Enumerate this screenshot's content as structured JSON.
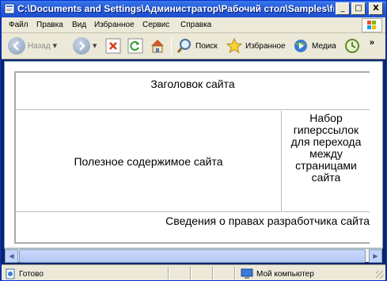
{
  "window": {
    "title": "C:\\Documents and Settings\\Администратор\\Рабочий стол\\Samples\\frame.ht...",
    "minimize": "_",
    "maximize": "□",
    "close": "X"
  },
  "menu": {
    "items": [
      "Файл",
      "Правка",
      "Вид",
      "Избранное",
      "Сервис",
      "Справка"
    ]
  },
  "toolbar": {
    "back_label": "Назад",
    "search_label": "Поиск",
    "favorites_label": "Избранное",
    "media_label": "Медиа",
    "overflow": "»"
  },
  "page": {
    "header": "Заголовок сайта",
    "main": "Полезное содержимое сайта",
    "nav": "Набор гиперссылок для перехода между страницами сайта",
    "footer": "Сведения о правах разработчика сайта"
  },
  "status": {
    "left": "Готово",
    "right": "Мой компьютер"
  },
  "colors": {
    "titlebar": "#245edb",
    "chrome": "#ece9d8",
    "scroll": "#c1d3fb"
  }
}
